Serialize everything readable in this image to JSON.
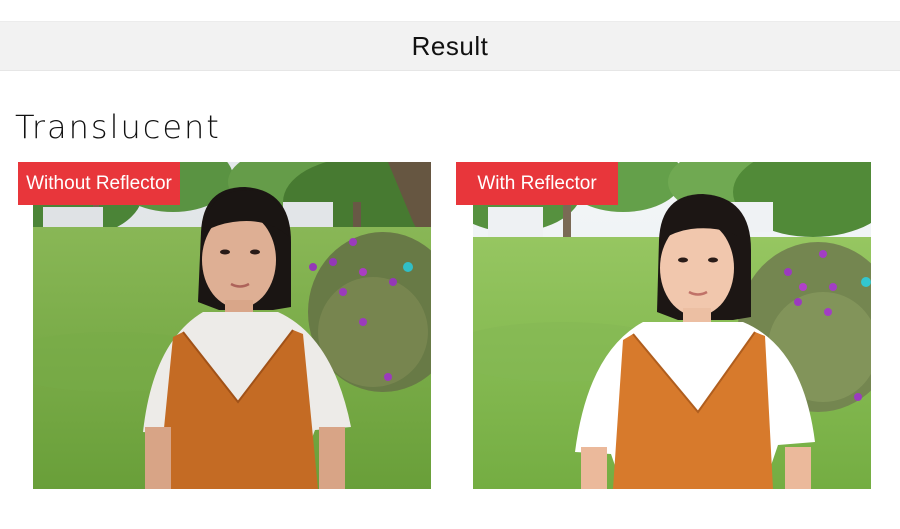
{
  "header": {
    "title": "Result"
  },
  "section": {
    "title": "Translucent"
  },
  "comparison": [
    {
      "label": "Without Reflector"
    },
    {
      "label": "With Reflector"
    }
  ]
}
